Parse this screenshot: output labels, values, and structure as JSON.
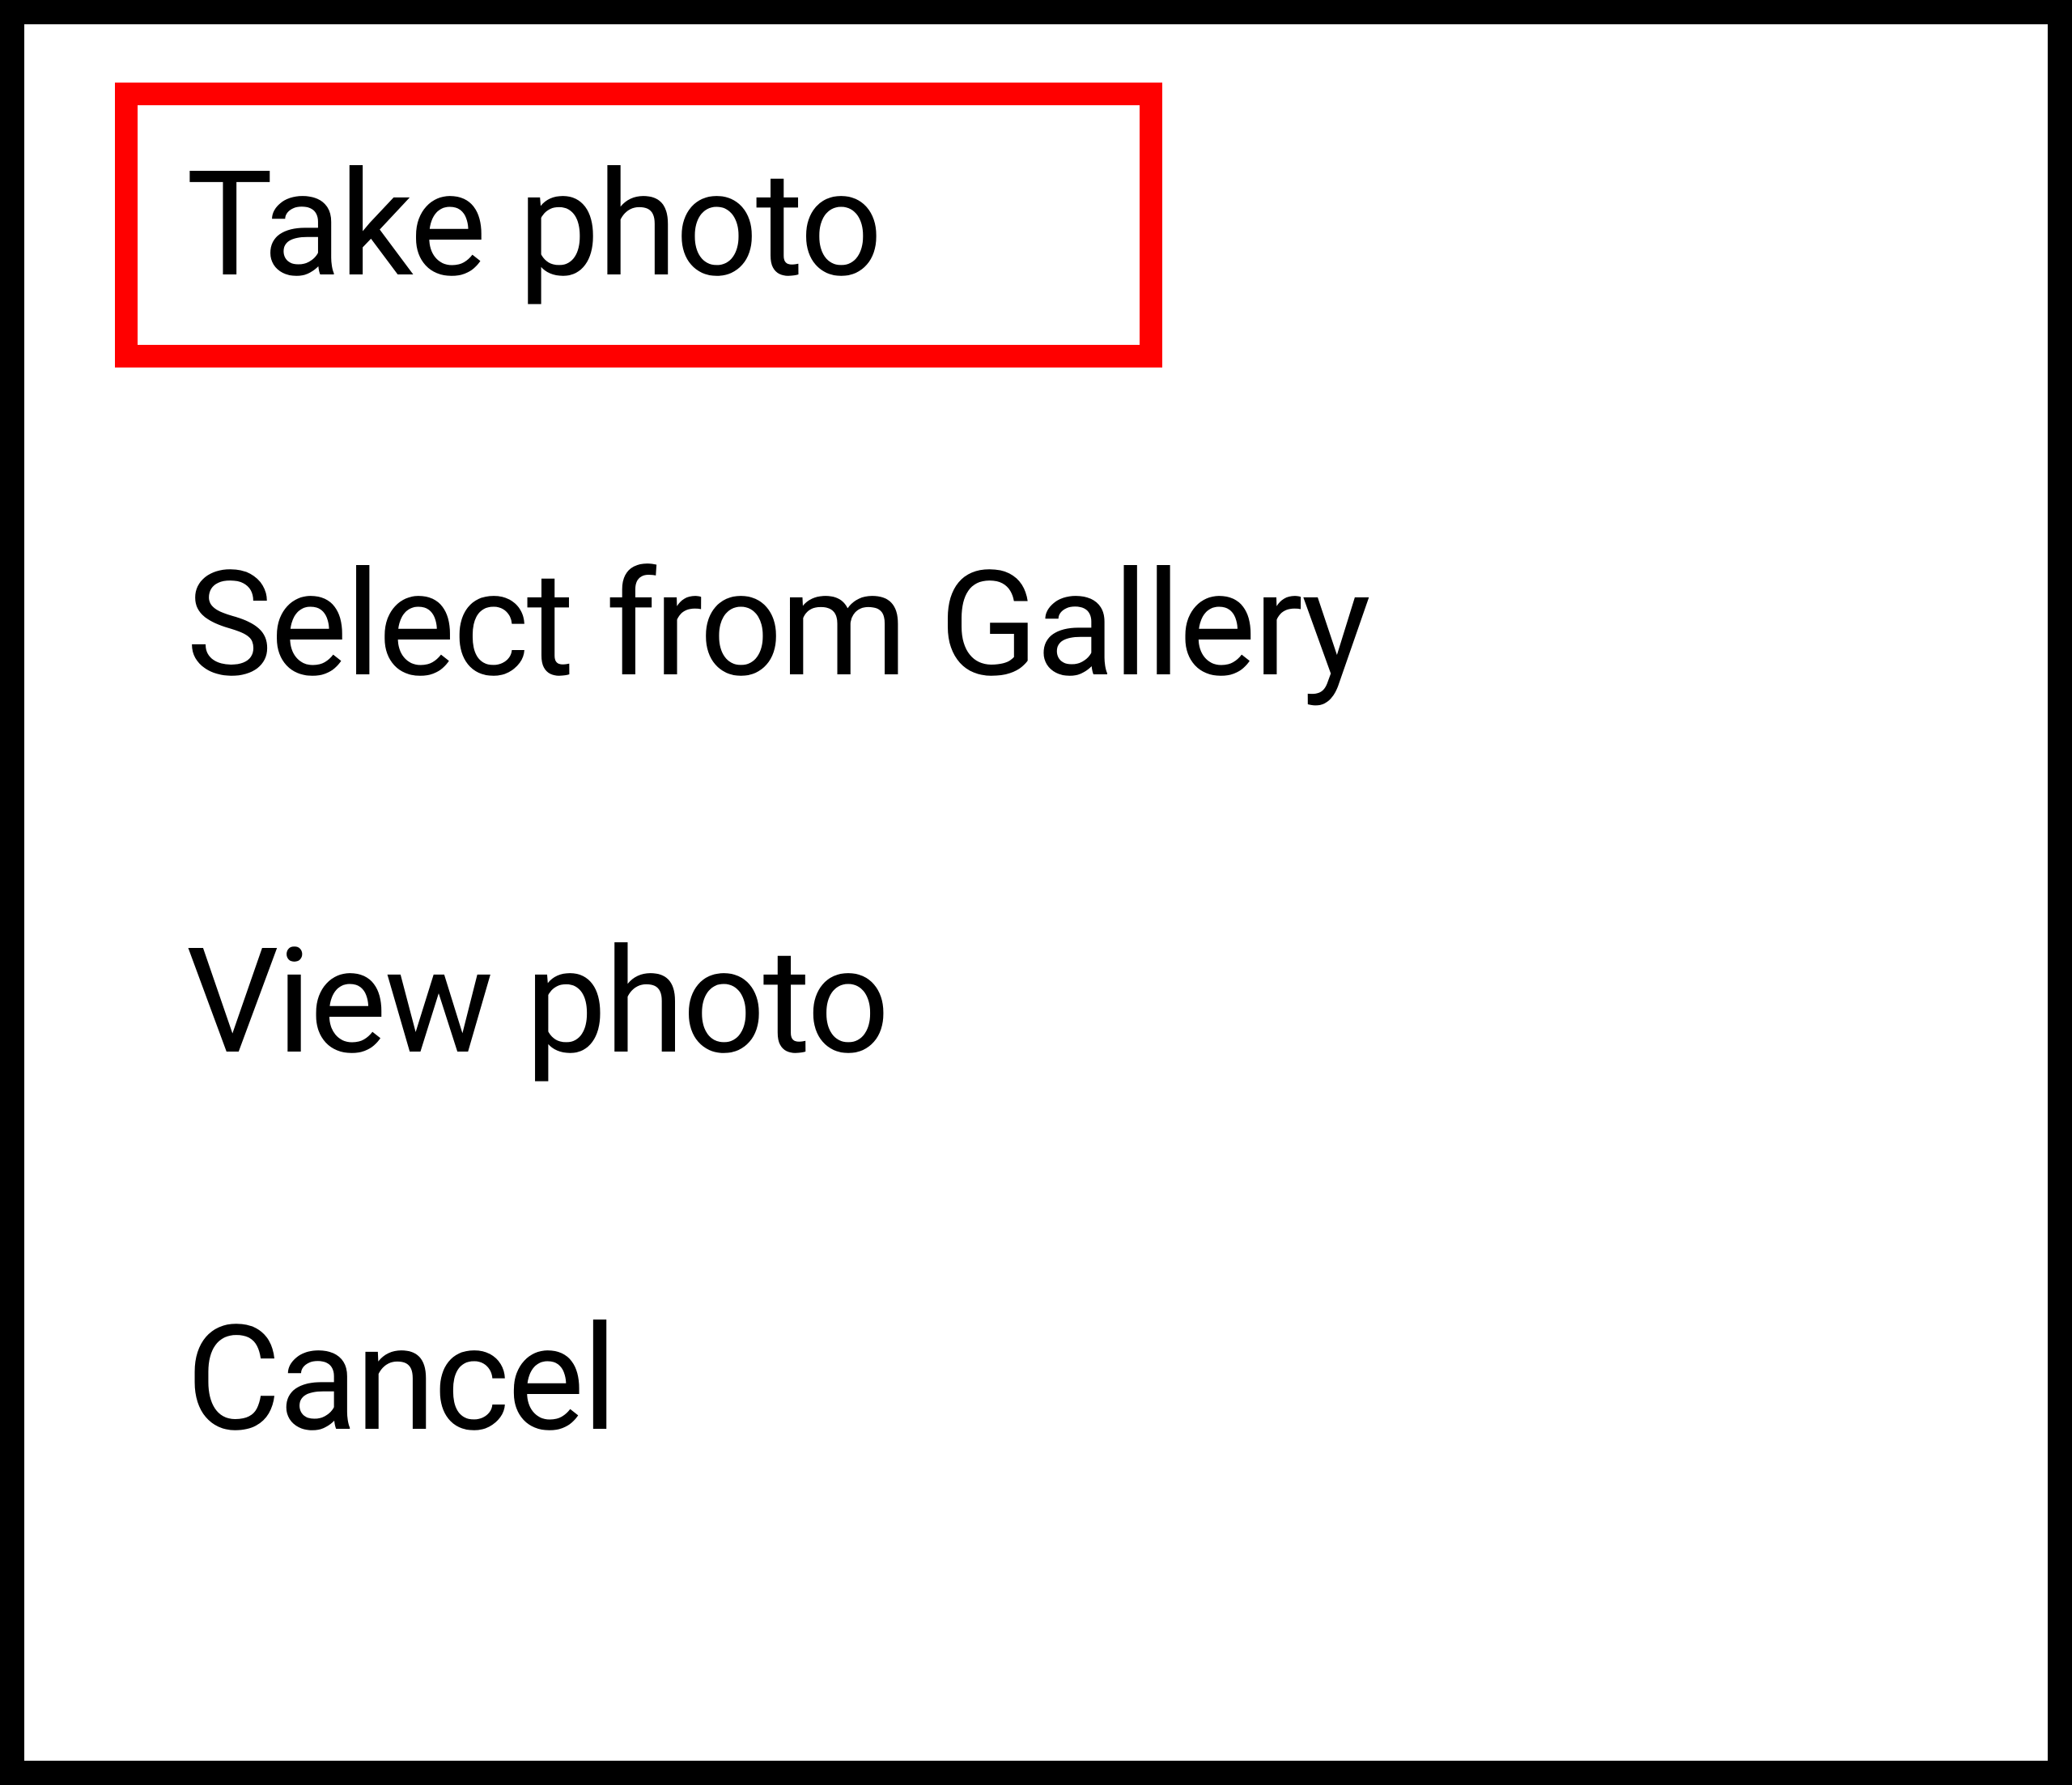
{
  "menu": {
    "items": [
      {
        "label": "Take photo",
        "highlighted": true
      },
      {
        "label": "Select from Gallery",
        "highlighted": false
      },
      {
        "label": "View photo",
        "highlighted": false
      },
      {
        "label": "Cancel",
        "highlighted": false
      }
    ]
  },
  "colors": {
    "highlight": "#ff0000",
    "border": "#000000",
    "text": "#000000",
    "background": "#ffffff"
  }
}
